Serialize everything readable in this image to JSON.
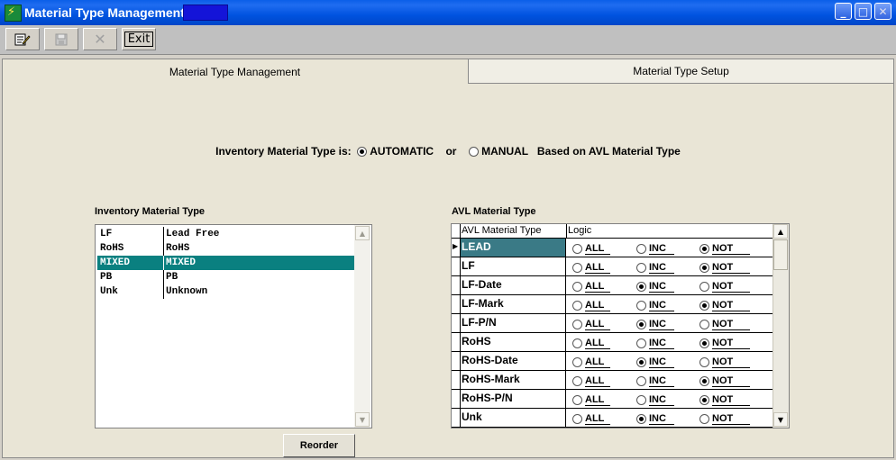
{
  "window": {
    "title": "Material Type Management",
    "buttons": {
      "minimize": "_",
      "maximize": "□",
      "close": "✕"
    }
  },
  "toolbar": {
    "edit_icon": "edit-icon",
    "save_icon": "save-icon",
    "cancel_glyph": "✕",
    "exit_label": "Exit"
  },
  "tabs": [
    {
      "label": "Material Type Management",
      "active": true
    },
    {
      "label": "Material Type Setup",
      "active": false
    }
  ],
  "mode": {
    "prefix": "Inventory Material Type is:",
    "automatic_label": "AUTOMATIC",
    "or_label": "or",
    "manual_label": "MANUAL",
    "suffix": "Based on AVL Material Type",
    "selected": "AUTOMATIC"
  },
  "inventory": {
    "title": "Inventory Material Type",
    "rows": [
      {
        "code": "LF",
        "desc": "Lead Free",
        "selected": false
      },
      {
        "code": "RoHS",
        "desc": "RoHS",
        "selected": false
      },
      {
        "code": "MIXED",
        "desc": "MIXED",
        "selected": true
      },
      {
        "code": "PB",
        "desc": "PB",
        "selected": false
      },
      {
        "code": "Unk",
        "desc": "Unknown",
        "selected": false
      }
    ],
    "reorder_label": "Reorder",
    "scroll_up": "▲",
    "scroll_down": "▼"
  },
  "avl": {
    "title": "AVL Material Type",
    "col_type": "AVL Material Type",
    "col_logic": "Logic",
    "opt_all": "ALL",
    "opt_inc": "INC",
    "opt_not": "NOT",
    "current_marker": "▶",
    "scroll_up": "▲",
    "scroll_down": "▼",
    "rows": [
      {
        "name": "LEAD",
        "logic": "NOT"
      },
      {
        "name": "LF",
        "logic": "NOT"
      },
      {
        "name": "LF-Date",
        "logic": "INC"
      },
      {
        "name": "LF-Mark",
        "logic": "NOT"
      },
      {
        "name": "LF-P/N",
        "logic": "INC"
      },
      {
        "name": "RoHS",
        "logic": "NOT"
      },
      {
        "name": "RoHS-Date",
        "logic": "INC"
      },
      {
        "name": "RoHS-Mark",
        "logic": "NOT"
      },
      {
        "name": "RoHS-P/N",
        "logic": "NOT"
      },
      {
        "name": "Unk",
        "logic": "INC"
      }
    ]
  }
}
